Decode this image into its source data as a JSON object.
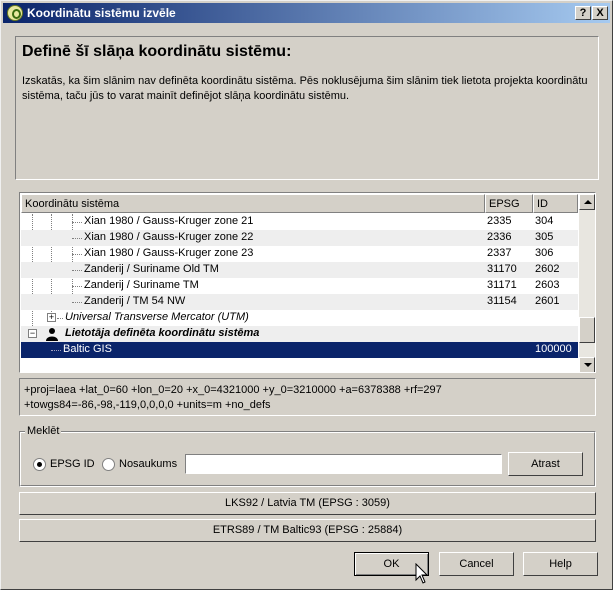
{
  "window": {
    "title": "Koordinātu sistēmu izvēle",
    "help_label": "?",
    "close_label": "X"
  },
  "info": {
    "heading": "Definē šī slāņa koordinātu sistēmu:",
    "description": "Izskatās, ka šim slānim nav definēta koordinātu sistēma. Pēs noklusējuma šim slānim tiek lietota projekta koordinātu sistēma, taču jūs to varat mainīt definējot slāņa koordinātu sistēmu."
  },
  "tree": {
    "columns": [
      "Koordinātu sistēma",
      "EPSG",
      "ID"
    ],
    "rows": [
      {
        "name": "Xian 1980 / Gauss-Kruger zone 21",
        "epsg": "2335",
        "id": "304"
      },
      {
        "name": "Xian 1980 / Gauss-Kruger zone 22",
        "epsg": "2336",
        "id": "305"
      },
      {
        "name": "Xian 1980 / Gauss-Kruger zone 23",
        "epsg": "2337",
        "id": "306"
      },
      {
        "name": "Zanderij / Suriname Old TM",
        "epsg": "31170",
        "id": "2602"
      },
      {
        "name": "Zanderij / Suriname TM",
        "epsg": "31171",
        "id": "2603"
      },
      {
        "name": "Zanderij / TM 54 NW",
        "epsg": "31154",
        "id": "2601"
      },
      {
        "name": "Universal Transverse Mercator (UTM)",
        "epsg": "",
        "id": ""
      },
      {
        "name": "Lietotāja definēta koordinātu sistēma",
        "epsg": "",
        "id": ""
      },
      {
        "name": "Baltic GIS",
        "epsg": "",
        "id": "100000"
      }
    ],
    "expand_symbol": "+",
    "collapse_symbol": "−"
  },
  "projection": {
    "line1": "+proj=laea +lat_0=60 +lon_0=20 +x_0=4321000 +y_0=3210000 +a=6378388 +rf=297",
    "line2": "+towgs84=-86,-98,-119,0,0,0,0 +units=m +no_defs"
  },
  "search": {
    "group_label": "Meklēt",
    "radio_epsg": "EPSG ID",
    "radio_name": "Nosaukums",
    "value": "",
    "find_label": "Atrast"
  },
  "recent": [
    "LKS92 / Latvia TM (EPSG : 3059)",
    "ETRS89 / TM Baltic93 (EPSG : 25884)"
  ],
  "buttons": {
    "ok": "OK",
    "cancel": "Cancel",
    "help": "Help"
  }
}
